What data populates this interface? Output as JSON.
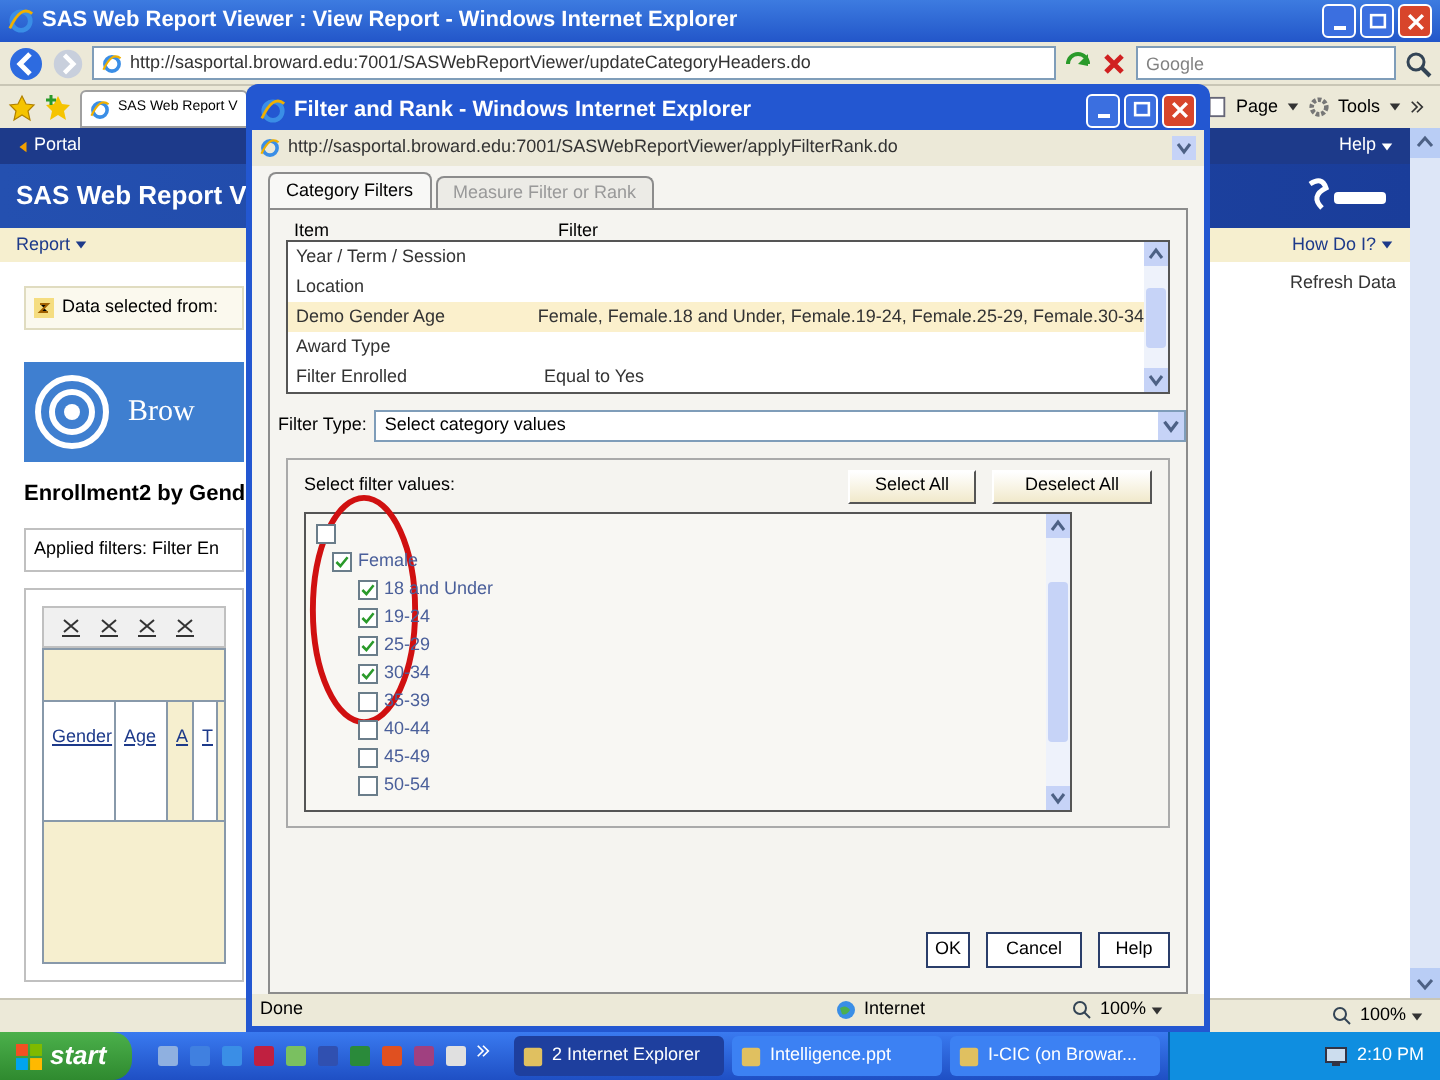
{
  "browser": {
    "title": "SAS Web Report Viewer : View Report - Windows Internet Explorer",
    "address": "http://sasportal.broward.edu:7001/SASWebReportViewer/updateCategoryHeaders.do",
    "search_placeholder": "Google",
    "tab": "SAS Web Report V",
    "toolbar": [
      "Page",
      "Tools"
    ],
    "zoom": "100%"
  },
  "page": {
    "portal": "Portal",
    "help": "Help",
    "banner": "SAS Web Report V",
    "menu": "Report",
    "how_do_i": "How Do I?",
    "refresh": "Refresh Data",
    "data_selected": "Data selected from:",
    "logo_text": "Brow",
    "report_title": "Enrollment2 by Gend",
    "applied_filters": "Applied filters:  Filter En",
    "columns": [
      "Gender",
      "Age",
      "A",
      "T"
    ]
  },
  "dialog": {
    "title": "Filter and Rank - Windows Internet Explorer",
    "address": "http://sasportal.broward.edu:7001/SASWebReportViewer/applyFilterRank.do",
    "tabs": [
      {
        "label": "Category Filters",
        "selected": true
      },
      {
        "label": "Measure Filter or Rank",
        "selected": false
      }
    ],
    "columns": [
      "Item",
      "Filter"
    ],
    "rows": [
      {
        "item": "Year / Term / Session",
        "filter": null,
        "selected": false
      },
      {
        "item": "Location",
        "filter": null,
        "selected": false
      },
      {
        "item": "Demo Gender Age",
        "filter": "Female, Female.18 and Under, Female.19-24, Female.25-29, Female.30-34",
        "selected": true
      },
      {
        "item": "Award Type",
        "filter": null,
        "selected": false
      },
      {
        "item": "Filter Enrolled",
        "filter": "Equal to Yes",
        "selected": false
      }
    ],
    "filter_type_label": "Filter Type:",
    "filter_type": "Select category values",
    "values_label": "Select filter values:",
    "select_all": "Select All",
    "deselect_all": "Deselect All",
    "tree_root_checked": false,
    "tree": [
      {
        "label": "Female",
        "checked": true,
        "children": [
          {
            "label": "18 and Under",
            "checked": true
          },
          {
            "label": "19-24",
            "checked": true
          },
          {
            "label": "25-29",
            "checked": true
          },
          {
            "label": "30-34",
            "checked": true
          },
          {
            "label": "35-39",
            "checked": false
          },
          {
            "label": "40-44",
            "checked": false
          },
          {
            "label": "45-49",
            "checked": false
          },
          {
            "label": "50-54",
            "checked": false
          }
        ]
      }
    ],
    "buttons": [
      "OK",
      "Cancel",
      "Help"
    ],
    "status": "Done",
    "zone": "Internet",
    "zoom": "100%"
  },
  "taskbar": {
    "start": "start",
    "tasks": [
      {
        "label": "2 Internet Explorer",
        "selected": true
      },
      {
        "label": "Intelligence.ppt",
        "selected": false
      },
      {
        "label": "I-CIC (on Browar...",
        "selected": false
      }
    ],
    "clock": "2:10 PM"
  }
}
